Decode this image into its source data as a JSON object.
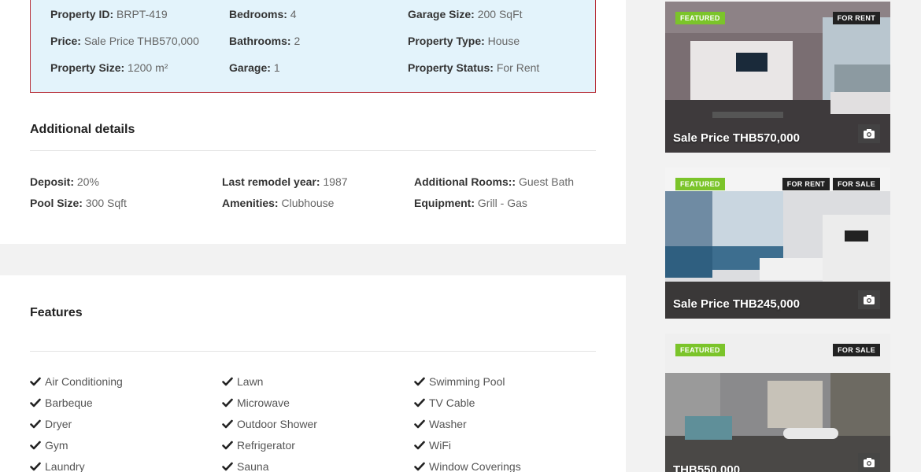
{
  "details": [
    {
      "label": "Property ID:",
      "value": "BRPT-419"
    },
    {
      "label": "Bedrooms:",
      "value": "4"
    },
    {
      "label": "Garage Size:",
      "value": "200 SqFt"
    },
    {
      "label": "Price:",
      "value": "Sale Price THB570,000"
    },
    {
      "label": "Bathrooms:",
      "value": "2"
    },
    {
      "label": "Property Type:",
      "value": "House"
    },
    {
      "label": "Property Size:",
      "value": "1200 m²"
    },
    {
      "label": "Garage:",
      "value": "1"
    },
    {
      "label": "Property Status:",
      "value": "For Rent"
    }
  ],
  "additional": {
    "title": "Additional details",
    "items": [
      {
        "label": "Deposit:",
        "value": "20%"
      },
      {
        "label": "Last remodel year:",
        "value": "1987"
      },
      {
        "label": "Additional Rooms::",
        "value": "Guest Bath"
      },
      {
        "label": "Pool Size:",
        "value": "300 Sqft"
      },
      {
        "label": "Amenities:",
        "value": "Clubhouse"
      },
      {
        "label": "Equipment:",
        "value": "Grill - Gas"
      }
    ]
  },
  "features": {
    "title": "Features",
    "columns": [
      [
        "Air Conditioning",
        "Barbeque",
        "Dryer",
        "Gym",
        "Laundry"
      ],
      [
        "Lawn",
        "Microwave",
        "Outdoor Shower",
        "Refrigerator",
        "Sauna"
      ],
      [
        "Swimming Pool",
        "TV Cable",
        "Washer",
        "WiFi",
        "Window Coverings"
      ]
    ],
    "check_icon": "check-icon"
  },
  "listings": [
    {
      "featured": "FEATURED",
      "statuses": [
        "FOR RENT"
      ],
      "price": "Sale Price THB570,000"
    },
    {
      "featured": "FEATURED",
      "statuses": [
        "FOR RENT",
        "FOR SALE"
      ],
      "price": "Sale Price THB245,000"
    },
    {
      "featured": "FEATURED",
      "statuses": [
        "FOR SALE"
      ],
      "price": "THB550,000"
    }
  ],
  "colors": {
    "accent_border": "#b8343e",
    "featured_badge": "#7bc42a",
    "detail_bg": "#e3f3fb"
  }
}
